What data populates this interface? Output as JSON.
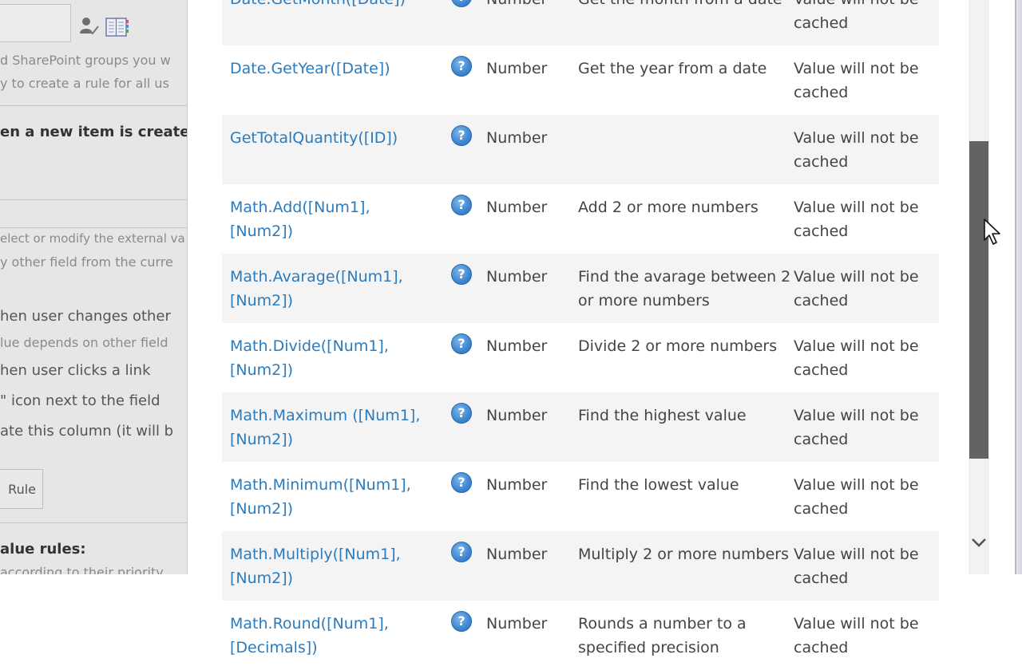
{
  "background_page": {
    "line_sharepoint_groups": "d SharePoint groups you w",
    "line_create_rule": "y to create a rule for all us",
    "heading_new_item": "en a new item is create",
    "line_select_modify": "elect or modify the external va",
    "line_other_field": "y other field from the curre",
    "option_user_changes": "hen user changes other",
    "option_depends": "lue depends on other field",
    "option_clicks_link": "hen user clicks a link",
    "option_icon_next": "\" icon next to the field",
    "option_update_column": "ate this column (it will b",
    "rule_button": "Rule",
    "heading_value_rules": "alue rules:",
    "line_priority": "according to their priority"
  },
  "functions_table": {
    "help_glyph": "?",
    "rows": [
      {
        "name": "Date.GetMonth([Date])",
        "type": "Number",
        "description": "Get the month from a date",
        "cache": "Value will not be cached"
      },
      {
        "name": "Date.GetYear([Date])",
        "type": "Number",
        "description": "Get the year from a date",
        "cache": "Value will not be cached"
      },
      {
        "name": "GetTotalQuantity([ID])",
        "type": "Number",
        "description": "",
        "cache": "Value will not be cached"
      },
      {
        "name": "Math.Add([Num1], [Num2])",
        "type": "Number",
        "description": "Add 2 or more numbers",
        "cache": "Value will not be cached"
      },
      {
        "name": "Math.Avarage([Num1], [Num2])",
        "type": "Number",
        "description": "Find the avarage between 2 or more numbers",
        "cache": "Value will not be cached"
      },
      {
        "name": "Math.Divide([Num1], [Num2])",
        "type": "Number",
        "description": "Divide 2 or more numbers",
        "cache": "Value will not be cached"
      },
      {
        "name": "Math.Maximum ([Num1], [Num2])",
        "type": "Number",
        "description": "Find the highest value",
        "cache": "Value will not be cached"
      },
      {
        "name": "Math.Minimum([Num1], [Num2])",
        "type": "Number",
        "description": "Find the lowest value",
        "cache": "Value will not be cached"
      },
      {
        "name": "Math.Multiply([Num1], [Num2])",
        "type": "Number",
        "description": "Multiply 2 or more numbers",
        "cache": "Value will not be cached"
      },
      {
        "name": "Math.Round([Num1], [Decimals])",
        "type": "Number",
        "description": "Rounds a number to a specified precision",
        "cache": "Value will not be cached"
      }
    ]
  },
  "scrollbar": {
    "position_fraction": 0.35,
    "visible_fraction": 0.55
  },
  "icons": {
    "people_picker": "people-check-icon",
    "address_book": "address-book-icon",
    "help": "help-icon",
    "scroll_down": "chevron-down-icon",
    "cursor": "mouse-pointer-icon"
  },
  "colors": {
    "link": "#2b7bbd",
    "help_icon": "#3d86d1",
    "scroll_thumb": "#636363",
    "alt_row": "#f4f4f4"
  }
}
